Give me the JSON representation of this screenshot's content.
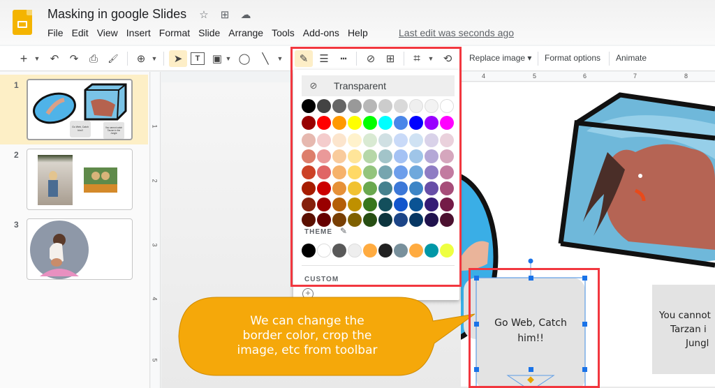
{
  "app": {
    "title": "Masking in google Slides",
    "last_edit": "Last edit was seconds ago"
  },
  "title_icons": [
    {
      "name": "star-icon",
      "glyph": "☆"
    },
    {
      "name": "move-to-folder-icon",
      "glyph": "⊞"
    },
    {
      "name": "cloud-status-icon",
      "glyph": "☁"
    }
  ],
  "menu": [
    "File",
    "Edit",
    "View",
    "Insert",
    "Format",
    "Slide",
    "Arrange",
    "Tools",
    "Add-ons",
    "Help"
  ],
  "toolbar": {
    "new_slide": "+",
    "undo": "↶",
    "redo": "↷",
    "print": "⎙",
    "paint_format": "🖌",
    "zoom": "⊕",
    "select": "➤",
    "textbox": "T",
    "image": "▣",
    "shape": "◯",
    "line": "╲",
    "border_color": "✎",
    "border_weight": "☰",
    "border_dash": "┅",
    "link": "⊘",
    "comment": "⊞",
    "crop": "⌗",
    "reset_image": "⟲",
    "replace_image": "Replace image ▾",
    "format_options": "Format options",
    "animate": "Animate"
  },
  "slides": [
    {
      "number": "1",
      "selected": true,
      "caption_a": "Go Web, Catch him!!",
      "caption_b": "You cannot catch Tarzan in the Jungle"
    },
    {
      "number": "2",
      "selected": false
    },
    {
      "number": "3",
      "selected": false
    }
  ],
  "ruler": {
    "horizontal": [
      "4",
      "5",
      "6",
      "7",
      "8"
    ],
    "vertical": [
      "1",
      "2",
      "3",
      "4",
      "5"
    ]
  },
  "palette": {
    "transparent_label": "Transparent",
    "theme_label": "THEME",
    "custom_label": "CUSTOM",
    "standard_rows": [
      [
        "#000000",
        "#434343",
        "#666666",
        "#999999",
        "#b7b7b7",
        "#cccccc",
        "#d9d9d9",
        "#efefef",
        "#f3f3f3",
        "#ffffff"
      ],
      [
        "#980000",
        "#ff0000",
        "#ff9900",
        "#ffff00",
        "#00ff00",
        "#00ffff",
        "#4a86e8",
        "#0000ff",
        "#9900ff",
        "#ff00ff"
      ],
      [
        "#e6b8af",
        "#f4cccc",
        "#fce5cd",
        "#fff2cc",
        "#d9ead3",
        "#d0e0e3",
        "#c9daf8",
        "#cfe2f3",
        "#d9d2e9",
        "#ead1dc"
      ],
      [
        "#dd7e6b",
        "#ea9999",
        "#f9cb9c",
        "#ffe599",
        "#b6d7a8",
        "#a2c4c9",
        "#a4c2f4",
        "#9fc5e8",
        "#b4a7d6",
        "#d5a6bd"
      ],
      [
        "#cc4125",
        "#e06666",
        "#f6b26b",
        "#ffd966",
        "#93c47d",
        "#76a5af",
        "#6d9eeb",
        "#6fa8dc",
        "#8e7cc3",
        "#c27ba0"
      ],
      [
        "#a61c00",
        "#cc0000",
        "#e69138",
        "#f1c232",
        "#6aa84f",
        "#45818e",
        "#3c78d8",
        "#3d85c6",
        "#674ea7",
        "#a64d79"
      ],
      [
        "#85200c",
        "#990000",
        "#b45f06",
        "#bf9000",
        "#38761d",
        "#134f5c",
        "#1155cc",
        "#0b5394",
        "#351c75",
        "#741b47"
      ],
      [
        "#5b0f00",
        "#660000",
        "#783f04",
        "#7f6000",
        "#274e13",
        "#0c343d",
        "#1c4587",
        "#073763",
        "#20124d",
        "#4c1130"
      ]
    ],
    "theme_colors": [
      "#000000",
      "#ffffff",
      "#595959",
      "#eeeeee",
      "#ffab40",
      "#212121",
      "#78909c",
      "#ffab40",
      "#0097a7",
      "#eeff41"
    ]
  },
  "callout": {
    "text_lines": [
      "We can change the",
      "border color, crop the",
      "image, etc from toolbar"
    ],
    "color": "#f5a80a"
  },
  "slide_content": {
    "bubble_lines": [
      "Go Web, Catch",
      "him!!"
    ],
    "bubble2_lines": [
      "You cannot",
      "Tarzan i",
      "Jungl"
    ]
  },
  "colors": {
    "highlight": "#f2373f",
    "selection": "#1a73e8"
  }
}
